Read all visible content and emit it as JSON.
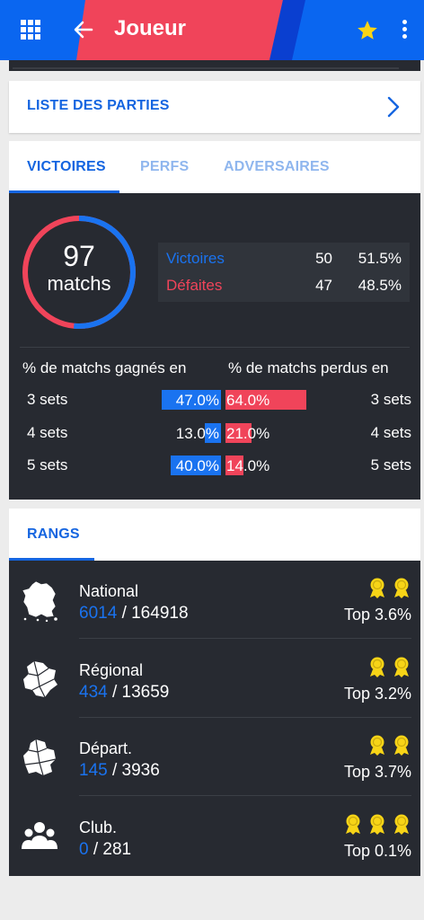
{
  "header": {
    "title": "Joueur",
    "colors": {
      "blue": "#0a66f0",
      "red": "#f0445a"
    },
    "icons": [
      "grid-menu-icon",
      "back-arrow-icon",
      "star-icon",
      "more-vert-icon"
    ]
  },
  "list_card": {
    "label": "LISTE DES PARTIES"
  },
  "tabs": [
    {
      "label": "VICTOIRES",
      "active": true
    },
    {
      "label": "PERFS",
      "active": false
    },
    {
      "label": "ADVERSAIRES",
      "active": false
    }
  ],
  "summary": {
    "total": "97",
    "total_label": "matchs",
    "win_fraction": 0.515,
    "rows": [
      {
        "name": "Victoires",
        "count": "50",
        "pct": "51.5%"
      },
      {
        "name": "Défaites",
        "count": "47",
        "pct": "48.5%"
      }
    ]
  },
  "sets": {
    "head_won": "% de matchs gagnés en",
    "head_lost": "% de matchs perdus en",
    "rows": [
      {
        "label": "3 sets",
        "won": "47.0%",
        "won_value": 47.0,
        "lost": "64.0%",
        "lost_value": 64.0
      },
      {
        "label": "4 sets",
        "won": "13.0%",
        "won_value": 13.0,
        "lost": "21.0%",
        "lost_value": 21.0
      },
      {
        "label": "5 sets",
        "won": "40.0%",
        "won_value": 40.0,
        "lost": "14.0%",
        "lost_value": 14.0
      }
    ]
  },
  "ranks_tab": {
    "label": "RANGS"
  },
  "ranks": [
    {
      "name": "National",
      "position": "6014",
      "total": "/ 164918",
      "top": "Top 3.6%",
      "medals": 2,
      "icon": "france-map-icon"
    },
    {
      "name": "Régional",
      "position": "434",
      "total": "/ 13659",
      "top": "Top 3.2%",
      "medals": 2,
      "icon": "region-map-icon"
    },
    {
      "name": "Départ.",
      "position": "145",
      "total": "/ 3936",
      "top": "Top 3.7%",
      "medals": 2,
      "icon": "department-map-icon"
    },
    {
      "name": "Club.",
      "position": "0",
      "total": "/ 281",
      "top": "Top 0.1%",
      "medals": 3,
      "icon": "club-people-icon"
    }
  ]
}
